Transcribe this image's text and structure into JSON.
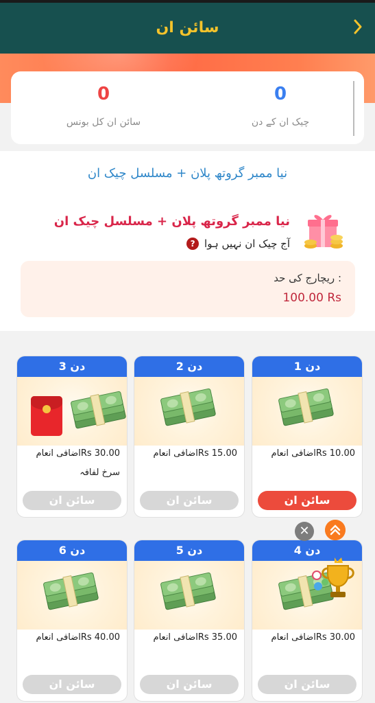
{
  "header": {
    "title": "سائن ان",
    "back_icon": "chevron-right-icon"
  },
  "stats": [
    {
      "value": "0",
      "label": "چیک ان کے دن",
      "color": "#3a7ff0"
    },
    {
      "value": "0",
      "label": "سائن ان کل بونس",
      "color": "#ee4444"
    }
  ],
  "plan": {
    "title": "نیا ممبر گروتھ پلان + مسلسل چیک ان",
    "name": "نیا ممبر گروتھ پلان + مسلسل چیک ان",
    "status": "آج چیک ان نہیں ہوا",
    "help_icon": "?",
    "recharge_label": "ریچارج کی حد  :",
    "recharge_amount": "100.00 Rs"
  },
  "days": [
    {
      "label": "دن 1",
      "reward": "اضافی انعامRs 10.00",
      "extra": "",
      "button": "سائن ان",
      "active": true
    },
    {
      "label": "دن 2",
      "reward": "اضافی انعامRs 15.00",
      "extra": "",
      "button": "سائن ان",
      "active": false
    },
    {
      "label": "دن 3",
      "reward": "اضافی انعامRs 30.00",
      "extra": "سرخ لفافہ",
      "button": "سائن ان",
      "active": false
    },
    {
      "label": "دن 4",
      "reward": "اضافی انعامRs 30.00",
      "extra": "",
      "button": "سائن ان",
      "active": false
    },
    {
      "label": "دن 5",
      "reward": "اضافی انعامRs 35.00",
      "extra": "",
      "button": "سائن ان",
      "active": false
    },
    {
      "label": "دن 6",
      "reward": "اضافی انعامRs 40.00",
      "extra": "",
      "button": "سائن ان",
      "active": false
    }
  ],
  "floating": {
    "close_icon": "✕",
    "scroll_up_icon": "double-chevron-up-icon"
  },
  "colors": {
    "header": "#17504f",
    "title": "#f5c32b",
    "accent_blue": "#2f6fe6",
    "accent_red": "#ec4b3c"
  }
}
